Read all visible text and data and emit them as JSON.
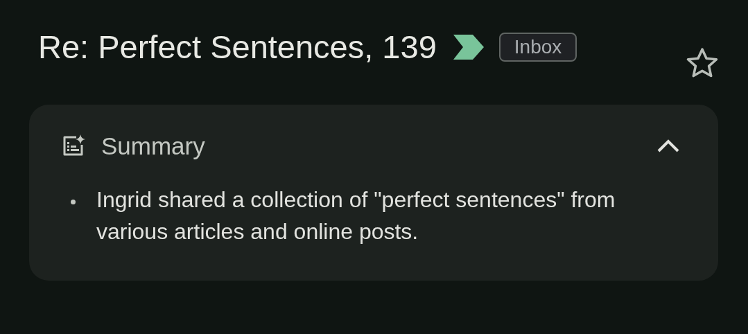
{
  "subject": "Re: Perfect Sentences, 139",
  "important": true,
  "label": "Inbox",
  "starred": false,
  "summary": {
    "heading": "Summary",
    "expanded": true,
    "bullets": [
      "Ingrid shared a collection of \"perfect sentences\" from various articles and online posts."
    ]
  }
}
